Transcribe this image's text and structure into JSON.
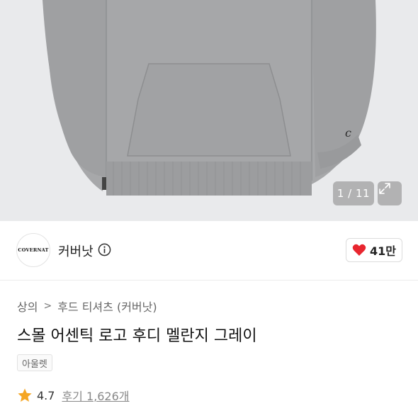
{
  "gallery": {
    "pager": "1 / 11",
    "colors": {
      "background": "#e9eaec",
      "hoodie": "#a7a8aa"
    }
  },
  "seller": {
    "logo_text": "COVERNAT",
    "name": "커버낫"
  },
  "like": {
    "count": "41만",
    "heart_color": "#e8262f"
  },
  "breadcrumb": {
    "items": [
      "상의",
      "후드 티셔츠 (커버낫)"
    ],
    "separator": ">"
  },
  "product": {
    "title": "스몰 어센틱 로고 후디 멜란지 그레이",
    "tag": "아울렛",
    "rating": "4.7",
    "reviews": "후기 1,626개",
    "star_color": "#f5a623"
  }
}
